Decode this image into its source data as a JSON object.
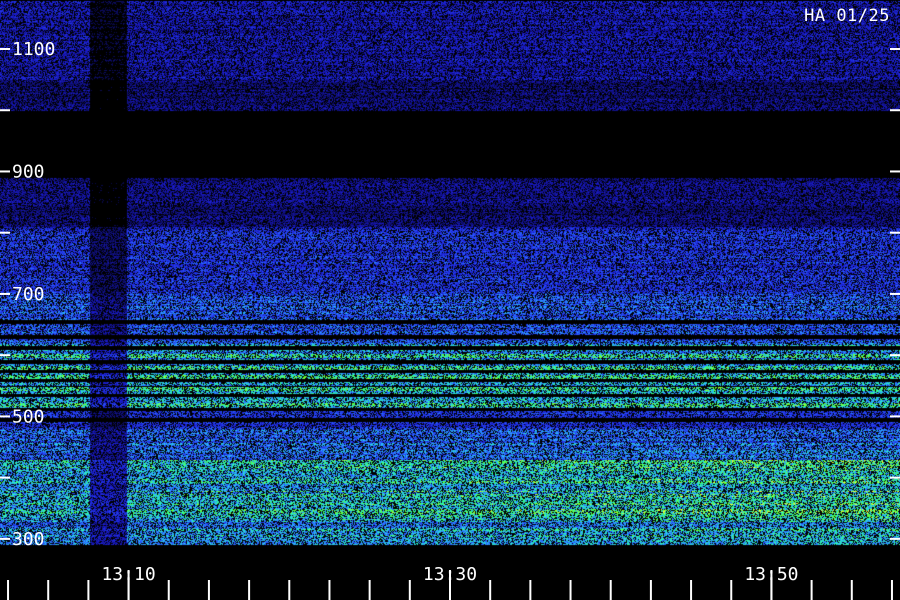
{
  "station_label": "HA 01/25",
  "chart_data": {
    "type": "heatmap",
    "title": "HA 01/25",
    "xlabel": "",
    "ylabel": "",
    "x_tick_labels": [
      "13:10",
      "13:30",
      "13:50"
    ],
    "x_tick_minutes": [
      10,
      30,
      50
    ],
    "x_range_minutes": [
      2,
      58
    ],
    "x_minor_step_minutes": 2.5,
    "y_tick_labels": [
      "300",
      "500",
      "700",
      "900",
      "1100"
    ],
    "y_tick_values": [
      300,
      500,
      700,
      900,
      1100
    ],
    "y_minor_values": [
      400,
      600,
      800,
      1000
    ],
    "y_range": [
      290,
      1180
    ],
    "colormap": [
      "#000000",
      "#1a1acc",
      "#2a55ff",
      "#2bb6ff",
      "#2bffb0",
      "#55ff2b",
      "#ffff40"
    ],
    "data_gap_minutes": [
      7.6,
      9.9
    ],
    "intensity_profile": [
      {
        "from": 290,
        "to": 330,
        "level": 0.42
      },
      {
        "from": 330,
        "to": 430,
        "level": 0.5
      },
      {
        "from": 430,
        "to": 480,
        "level": 0.32
      },
      {
        "from": 480,
        "to": 510,
        "level": 0.22
      },
      {
        "from": 510,
        "to": 620,
        "level": 0.4
      },
      {
        "from": 620,
        "to": 700,
        "level": 0.28
      },
      {
        "from": 700,
        "to": 810,
        "level": 0.22
      },
      {
        "from": 810,
        "to": 890,
        "level": 0.1
      },
      {
        "from": 890,
        "to": 1000,
        "level": 0.03
      },
      {
        "from": 1000,
        "to": 1050,
        "level": 0.1
      },
      {
        "from": 1050,
        "to": 1180,
        "level": 0.14
      }
    ],
    "dark_bands": [
      495,
      512,
      535,
      548,
      560,
      575,
      590,
      612,
      630,
      655
    ],
    "bright_bands": [
      520,
      545,
      565,
      580,
      600
    ]
  }
}
